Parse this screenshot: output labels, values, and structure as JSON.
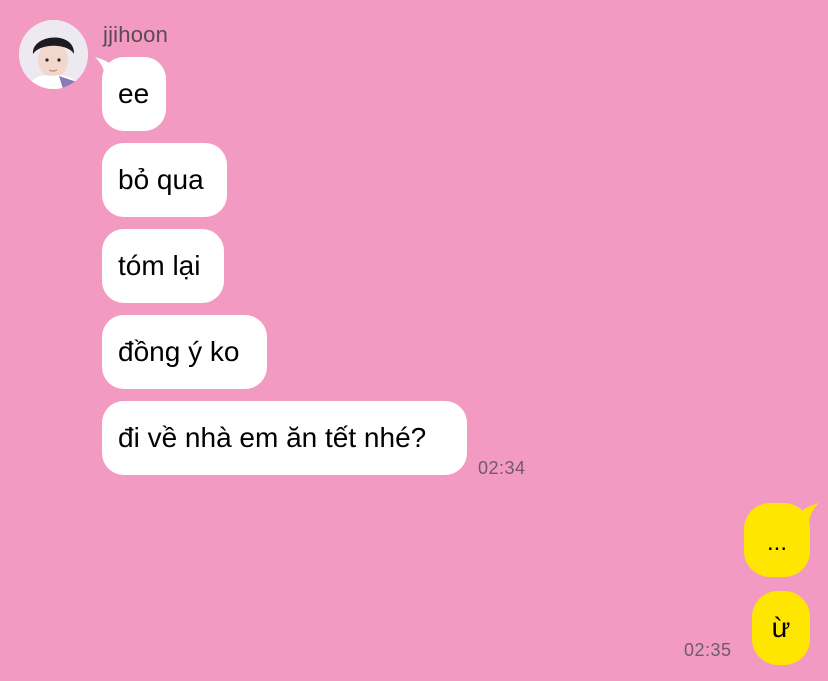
{
  "contact": {
    "name": "jjihoon"
  },
  "incoming": [
    {
      "text": "ee"
    },
    {
      "text": "bỏ qua"
    },
    {
      "text": "tóm lại"
    },
    {
      "text": "đồng ý ko"
    },
    {
      "text": "đi về nhà em ăn tết nhé?"
    }
  ],
  "incoming_time": "02:34",
  "outgoing": [
    {
      "text": "..."
    },
    {
      "text": "ừ"
    }
  ],
  "outgoing_time": "02:35",
  "colors": {
    "background": "#f39ac3",
    "incoming_bubble": "#ffffff",
    "outgoing_bubble": "#ffe600"
  }
}
